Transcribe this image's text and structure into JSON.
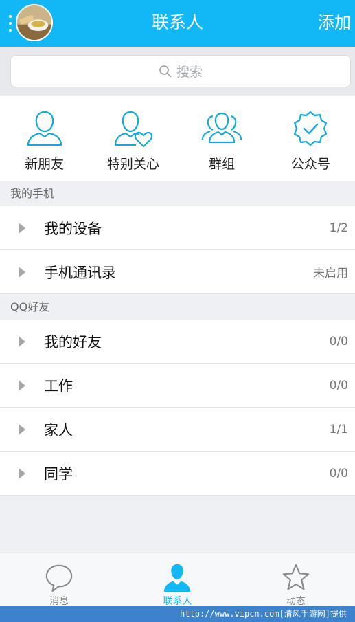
{
  "header": {
    "title": "联系人",
    "add_label": "添加"
  },
  "search": {
    "placeholder": "搜索"
  },
  "quick_actions": [
    {
      "label": "新朋友",
      "icon": "person-icon"
    },
    {
      "label": "特别关心",
      "icon": "person-heart-icon"
    },
    {
      "label": "群组",
      "icon": "group-icon"
    },
    {
      "label": "公众号",
      "icon": "badge-check-icon"
    }
  ],
  "sections": [
    {
      "title": "我的手机",
      "items": [
        {
          "name": "我的设备",
          "count": "1/2"
        },
        {
          "name": "手机通讯录",
          "count": "未启用"
        }
      ]
    },
    {
      "title": "QQ好友",
      "items": [
        {
          "name": "我的好友",
          "count": "0/0"
        },
        {
          "name": "工作",
          "count": "0/0"
        },
        {
          "name": "家人",
          "count": "1/1"
        },
        {
          "name": "同学",
          "count": "0/0"
        }
      ]
    }
  ],
  "bottom_nav": [
    {
      "label": "消息",
      "icon": "chat-bubble-icon",
      "active": false
    },
    {
      "label": "联系人",
      "icon": "contacts-person-icon",
      "active": true
    },
    {
      "label": "动态",
      "icon": "star-icon",
      "active": false
    }
  ],
  "watermark": "http://www.vipcn.com[清风手游网]提供",
  "colors": {
    "accent": "#12b7f5",
    "icon_stroke": "#14a9dc",
    "watermark_bg": "#3d82cc"
  }
}
